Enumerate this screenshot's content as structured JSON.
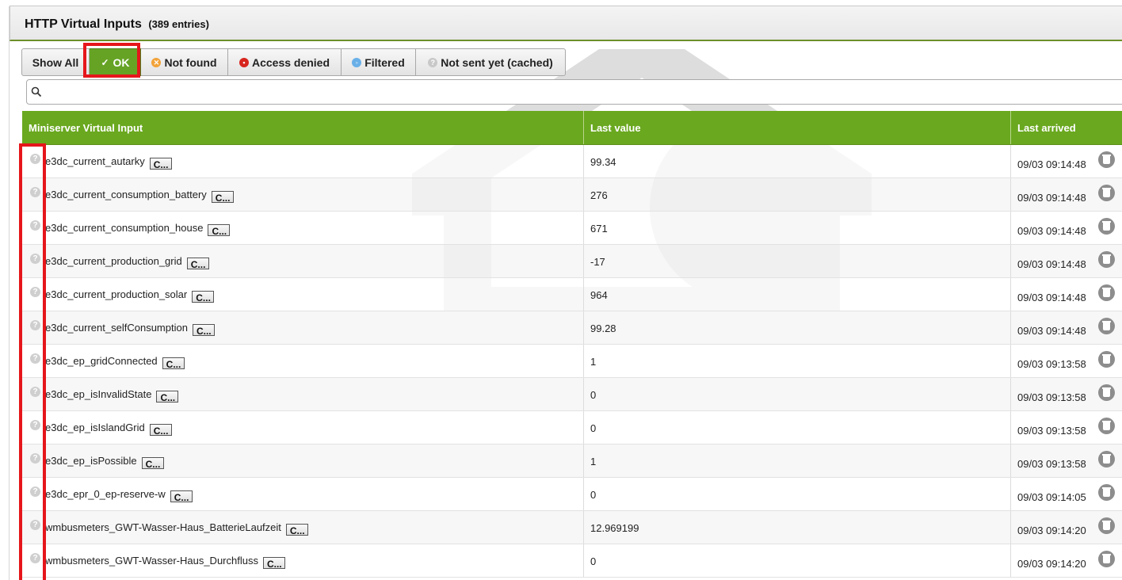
{
  "header": {
    "title": "HTTP Virtual Inputs",
    "count": "(389 entries)"
  },
  "filters": [
    {
      "label": "Show All",
      "icon": ""
    },
    {
      "label": "OK",
      "icon": "check-icon"
    },
    {
      "label": "Not found",
      "icon": "not-found-icon"
    },
    {
      "label": "Access denied",
      "icon": "lock-icon"
    },
    {
      "label": "Filtered",
      "icon": "filter-icon"
    },
    {
      "label": "Not sent yet (cached)",
      "icon": "question-icon"
    }
  ],
  "active_filter": "OK",
  "search": {
    "value": "",
    "placeholder": ""
  },
  "table": {
    "headers": [
      "Miniserver Virtual Input",
      "Last value",
      "Last arrived"
    ],
    "copy_button_label": "C...",
    "rows": [
      {
        "name": "e3dc_current_autarky",
        "value": "99.34",
        "arrived": "09/03 09:14:48"
      },
      {
        "name": "e3dc_current_consumption_battery",
        "value": "276",
        "arrived": "09/03 09:14:48"
      },
      {
        "name": "e3dc_current_consumption_house",
        "value": "671",
        "arrived": "09/03 09:14:48"
      },
      {
        "name": "e3dc_current_production_grid",
        "value": "-17",
        "arrived": "09/03 09:14:48"
      },
      {
        "name": "e3dc_current_production_solar",
        "value": "964",
        "arrived": "09/03 09:14:48"
      },
      {
        "name": "e3dc_current_selfConsumption",
        "value": "99.28",
        "arrived": "09/03 09:14:48"
      },
      {
        "name": "e3dc_ep_gridConnected",
        "value": "1",
        "arrived": "09/03 09:13:58"
      },
      {
        "name": "e3dc_ep_isInvalidState",
        "value": "0",
        "arrived": "09/03 09:13:58"
      },
      {
        "name": "e3dc_ep_isIslandGrid",
        "value": "0",
        "arrived": "09/03 09:13:58"
      },
      {
        "name": "e3dc_ep_isPossible",
        "value": "1",
        "arrived": "09/03 09:13:58"
      },
      {
        "name": "e3dc_epr_0_ep-reserve-w",
        "value": "0",
        "arrived": "09/03 09:14:05"
      },
      {
        "name": "wmbusmeters_GWT-Wasser-Haus_BatterieLaufzeit",
        "value": "12.969199",
        "arrived": "09/03 09:14:20"
      },
      {
        "name": "wmbusmeters_GWT-Wasser-Haus_Durchfluss",
        "value": "0",
        "arrived": "09/03 09:14:20"
      }
    ]
  },
  "colors": {
    "accent_green": "#6aa81f",
    "highlight_red": "#e5161b"
  }
}
